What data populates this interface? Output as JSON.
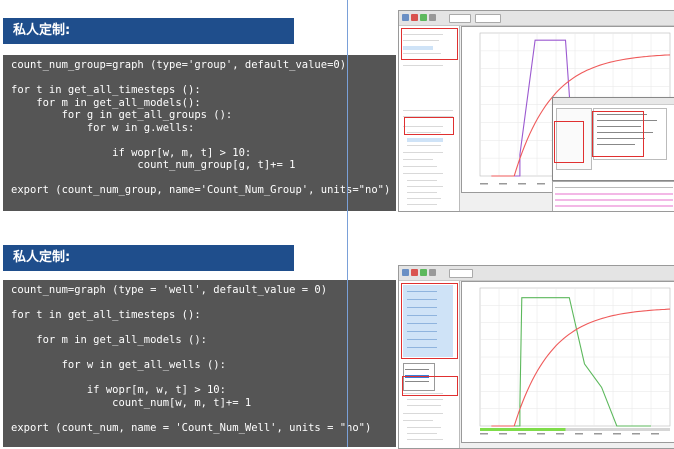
{
  "sections": [
    {
      "title": "私人定制:",
      "code_lines": [
        "count_num_group=graph (type='group', default_value=0)",
        "",
        "for t in get_all_timesteps ():",
        "    for m in get_all_models():",
        "        for g in get_all_groups ():",
        "            for w in g.wells:",
        "",
        "                if wopr[w, m, t] > 10:",
        "                    count_num_group[g, t]+= 1",
        "",
        "export (count_num_group, name='Count_Num_Group', units=\"no\")"
      ]
    },
    {
      "title": "私人定制:",
      "code_lines": [
        "count_num=graph (type = 'well', default_value = 0)",
        "",
        "for t in get_all_timesteps ():",
        "",
        "    for m in get_all_models ():",
        "",
        "        for w in get_all_wells ():",
        "",
        "            if wopr[m, w, t] > 10:",
        "                count_num[w, m, t]+= 1",
        "",
        "export (count_num, name = 'Count_Num_Well', units = \"no\")"
      ]
    }
  ],
  "screenshots": {
    "top": {
      "line_colors": {
        "step": "#9b59d0",
        "curve": "#ef5a5a"
      }
    },
    "bottom": {
      "line_colors": {
        "step": "#5cb85c",
        "curve": "#ef5a5a"
      }
    }
  },
  "colors": {
    "banner": "#1f4e8c",
    "code_bg": "#555555",
    "code_fg": "#ffffff",
    "highlight": "#e03030"
  }
}
